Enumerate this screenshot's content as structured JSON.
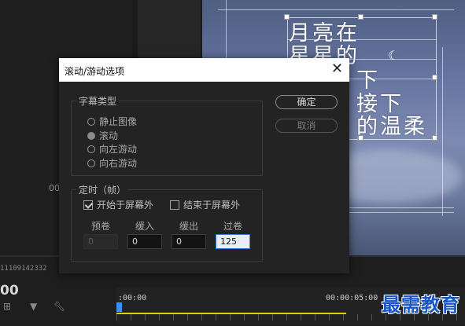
{
  "dialog": {
    "title": "滚动/游动选项",
    "close_icon": "close-icon",
    "caption_type": {
      "legend": "字幕类型",
      "options": [
        {
          "label": "静止图像",
          "selected": false
        },
        {
          "label": "滚动",
          "selected": true
        },
        {
          "label": "向左游动",
          "selected": false
        },
        {
          "label": "向右游动",
          "selected": false
        }
      ]
    },
    "timing": {
      "legend": "定时（帧）",
      "start_offscreen": {
        "label": "开始于屏幕外",
        "checked": true
      },
      "end_offscreen": {
        "label": "结束于屏幕外",
        "checked": false
      },
      "fields": [
        {
          "label": "预卷",
          "value": "0",
          "disabled": true
        },
        {
          "label": "缓入",
          "value": "0",
          "disabled": false
        },
        {
          "label": "缓出",
          "value": "0",
          "disabled": false
        },
        {
          "label": "过卷",
          "value": "125",
          "disabled": false,
          "focused": true
        }
      ]
    },
    "ok_label": "确定",
    "cancel_label": "取消"
  },
  "preview": {
    "poem_lines": [
      "月亮在",
      "星星的",
      "下",
      "接下",
      "的温柔"
    ],
    "moon_icon": "crescent-moon-icon"
  },
  "timeline": {
    "timecode_small": "11109142332",
    "timecode_big": "00",
    "timecode_side": "00",
    "ruler_start": ":00:00",
    "ruler_end": "00:00:05:00",
    "playhead_color": "#3b8fff",
    "inout_color": "#e4d000"
  },
  "watermark": "最需教育"
}
